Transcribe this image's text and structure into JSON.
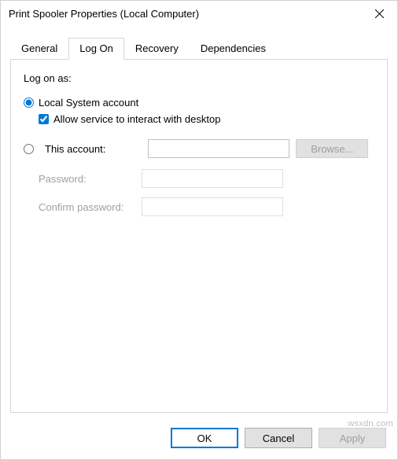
{
  "window": {
    "title": "Print Spooler Properties (Local Computer)"
  },
  "tabs": {
    "items": [
      {
        "label": "General"
      },
      {
        "label": "Log On"
      },
      {
        "label": "Recovery"
      },
      {
        "label": "Dependencies"
      }
    ],
    "active_index": 1
  },
  "logon": {
    "section_label": "Log on as:",
    "local_system_label": "Local System account",
    "interact_label": "Allow service to interact with desktop",
    "local_system_selected": true,
    "interact_checked": true,
    "this_account_label": "This account:",
    "this_account_selected": false,
    "account_value": "",
    "browse_label": "Browse...",
    "password_label": "Password:",
    "password_value": "",
    "confirm_label": "Confirm password:",
    "confirm_value": ""
  },
  "footer": {
    "ok": "OK",
    "cancel": "Cancel",
    "apply": "Apply"
  },
  "watermark": "wsxdn.com"
}
